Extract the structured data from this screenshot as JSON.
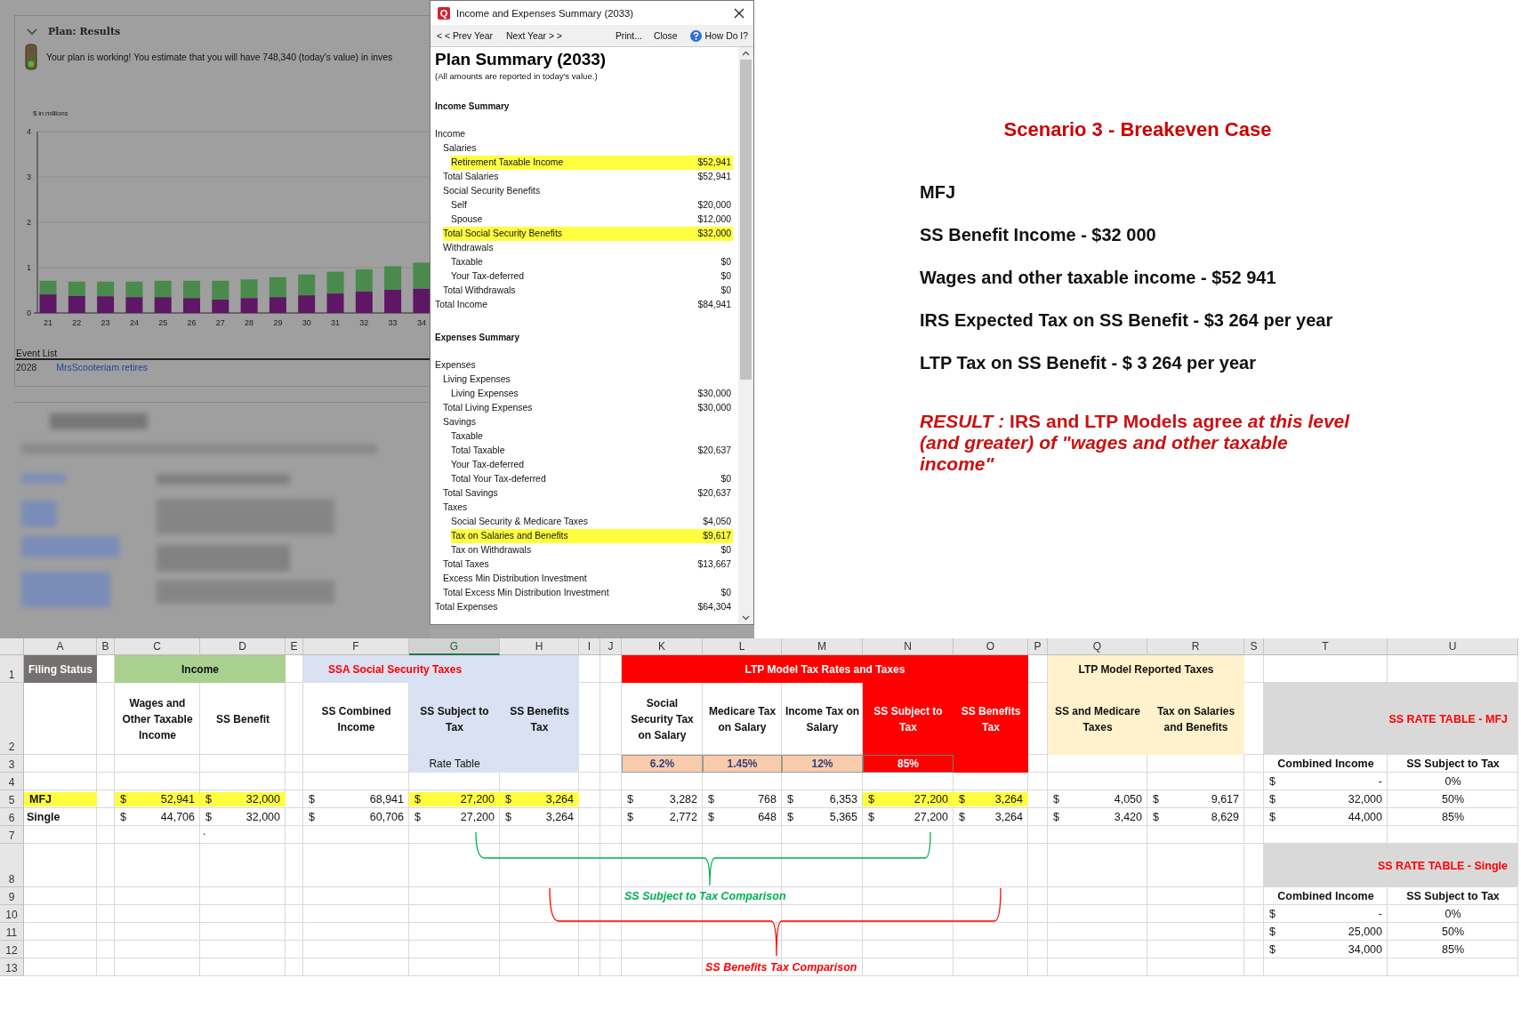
{
  "background_app": {
    "panel_title": "Plan: Results",
    "message": "Your plan is working! You estimate that you will have 748,340 (today's value) in inves",
    "chart_data": {
      "type": "bar",
      "stacked": true,
      "grid": true,
      "ylabel": "$ in millions",
      "categories": [
        "21",
        "22",
        "23",
        "24",
        "25",
        "26",
        "27",
        "28",
        "29",
        "30",
        "31",
        "32",
        "33",
        "34"
      ],
      "yticks": [
        0,
        1,
        2,
        3,
        4
      ],
      "ylim": [
        0,
        4
      ],
      "series": [
        {
          "color": "#5e1764",
          "values": [
            0.41,
            0.38,
            0.37,
            0.35,
            0.35,
            0.33,
            0.3,
            0.33,
            0.35,
            0.39,
            0.43,
            0.47,
            0.51,
            0.54
          ]
        },
        {
          "color": "#4a8a4c",
          "values": [
            0.3,
            0.31,
            0.32,
            0.34,
            0.36,
            0.38,
            0.41,
            0.41,
            0.44,
            0.46,
            0.48,
            0.49,
            0.52,
            0.57
          ]
        }
      ]
    },
    "event_list": {
      "title": "Event List",
      "events": [
        {
          "year": "2028",
          "description": "MrsScooteriam retires"
        }
      ]
    }
  },
  "dialog": {
    "app_icon_letter": "Q",
    "title": "Income and Expenses Summary (2033)",
    "toolbar": [
      {
        "label": "< < Prev Year",
        "kind": "nav"
      },
      {
        "label": "Next Year > >",
        "kind": "nav"
      },
      {
        "label": "Print...",
        "kind": "action"
      },
      {
        "label": "Close",
        "kind": "action"
      },
      {
        "label": "How Do I?",
        "kind": "help"
      }
    ],
    "heading": "Plan Summary (2033)",
    "note": "(All amounts are reported in today's value.)",
    "sections": [
      {
        "heading": "Income Summary",
        "items": [
          {
            "label": "Income",
            "children": [
              {
                "label": "Salaries",
                "children": [
                  {
                    "label": "Retirement Taxable Income",
                    "amount": "$52,941",
                    "highlighted": true
                  }
                ]
              },
              {
                "label": "Total Salaries",
                "amount": "$52,941",
                "highlighted": false
              },
              {
                "label": "Social Security Benefits",
                "children": [
                  {
                    "label": "Self",
                    "amount": "$20,000",
                    "highlighted": false
                  },
                  {
                    "label": "Spouse",
                    "amount": "$12,000",
                    "highlighted": false
                  }
                ]
              },
              {
                "label": "Total Social Security Benefits",
                "amount": "$32,000",
                "highlighted": true
              },
              {
                "label": "Withdrawals",
                "children": [
                  {
                    "label": "Taxable",
                    "amount": "$0",
                    "highlighted": false
                  },
                  {
                    "label": "Your Tax-deferred",
                    "amount": "$0",
                    "highlighted": false
                  }
                ]
              },
              {
                "label": "Total Withdrawals",
                "amount": "$0",
                "highlighted": false
              }
            ]
          },
          {
            "label": "Total Income",
            "amount": "$84,941",
            "highlighted": false
          }
        ]
      },
      {
        "heading": "Expenses Summary",
        "items": [
          {
            "label": "Expenses",
            "children": [
              {
                "label": "Living Expenses",
                "children": [
                  {
                    "label": "Living Expenses",
                    "amount": "$30,000",
                    "highlighted": false
                  }
                ]
              },
              {
                "label": "Total Living Expenses",
                "amount": "$30,000",
                "highlighted": false
              },
              {
                "label": "Savings",
                "children": [
                  {
                    "label": "Taxable"
                  },
                  {
                    "label": "Total Taxable",
                    "amount": "$20,637",
                    "highlighted": false
                  },
                  {
                    "label": "Your Tax-deferred"
                  },
                  {
                    "label": "Total Your Tax-deferred",
                    "amount": "$0",
                    "highlighted": false
                  }
                ]
              },
              {
                "label": "Total Savings",
                "amount": "$20,637",
                "highlighted": false
              },
              {
                "label": "Taxes",
                "children": [
                  {
                    "label": "Social Security & Medicare Taxes",
                    "amount": "$4,050",
                    "highlighted": false
                  },
                  {
                    "label": "Tax on Salaries and Benefits",
                    "amount": "$9,617",
                    "highlighted": true
                  },
                  {
                    "label": "Tax on Withdrawals",
                    "amount": "$0",
                    "highlighted": false
                  }
                ]
              },
              {
                "label": "Total Taxes",
                "amount": "$13,667",
                "highlighted": false
              },
              {
                "label": "Excess Min Distribution Investment"
              },
              {
                "label": "Total Excess Min Distribution Investment",
                "amount": "$0",
                "highlighted": false
              }
            ]
          },
          {
            "label": "Total Expenses",
            "amount": "$64,304",
            "highlighted": false
          }
        ]
      }
    ]
  },
  "scenario": {
    "title": "Scenario 3 - Breakeven Case",
    "lines": [
      "MFJ",
      "SS Benefit Income - $32 000",
      "Wages and other taxable income - $52 941",
      "IRS Expected Tax on SS Benefit -  $3 264 per year",
      "LTP Tax on SS Benefit - $ 3 264 per year"
    ],
    "result": "*RESULT :* IRS and LTP Models agree *at this level (and greater) of \"wages and other taxable income\"*"
  },
  "spreadsheet": {
    "column_letters": [
      {
        "label": "A",
        "selected": false
      },
      {
        "label": "B",
        "selected": false
      },
      {
        "label": "C",
        "selected": false
      },
      {
        "label": "D",
        "selected": false
      },
      {
        "label": "E",
        "selected": false
      },
      {
        "label": "F",
        "selected": false
      },
      {
        "label": "G",
        "selected": true
      },
      {
        "label": "H",
        "selected": false
      },
      {
        "label": "I",
        "selected": false
      },
      {
        "label": "J",
        "selected": false
      },
      {
        "label": "K",
        "selected": false
      },
      {
        "label": "L",
        "selected": false
      },
      {
        "label": "M",
        "selected": false
      },
      {
        "label": "N",
        "selected": false
      },
      {
        "label": "O",
        "selected": false
      },
      {
        "label": "P",
        "selected": false
      },
      {
        "label": "Q",
        "selected": false
      },
      {
        "label": "R",
        "selected": false
      },
      {
        "label": "S",
        "selected": false
      },
      {
        "label": "T",
        "selected": false
      },
      {
        "label": "U",
        "selected": false
      }
    ],
    "row_numbers": [
      "1",
      "2",
      "3",
      "4",
      "5",
      "6",
      "7",
      "8",
      "9",
      "10",
      "11",
      "12",
      "13"
    ],
    "groups": [
      "Filing Status",
      "Income",
      "SSA Social Security Taxes",
      "LTP Model Tax Rates and Taxes",
      "LTP Model Reported Taxes"
    ],
    "headers": [
      "Wages and Other Taxable Income",
      "SS Benefit",
      "SS Combined Income",
      "SS Subject to Tax",
      "SS Benefits Tax",
      "Social Security Tax on Salary",
      "Medicare Tax on Salary",
      "Income Tax on Salary",
      "SS Subject to Tax",
      "SS Benefits Tax",
      "SS and Medicare Taxes",
      "Tax on Salaries and Benefits"
    ],
    "rate_table_label": "Rate Table",
    "rates": [
      "6.2%",
      "1.45%",
      "12%",
      "85%"
    ],
    "rows": [
      {
        "status": "MFJ",
        "status_highlighted": true,
        "cells": [
          {
            "currency": "$",
            "amount": "52,941",
            "highlighted": true
          },
          {
            "currency": "$",
            "amount": "32,000",
            "highlighted": true
          },
          {
            "currency": "$",
            "amount": "68,941",
            "highlighted": false
          },
          {
            "currency": "$",
            "amount": "27,200",
            "highlighted": true
          },
          {
            "currency": "$",
            "amount": "3,264",
            "highlighted": true
          },
          {
            "currency": "$",
            "amount": "3,282",
            "highlighted": false
          },
          {
            "currency": "$",
            "amount": "768",
            "highlighted": false
          },
          {
            "currency": "$",
            "amount": "6,353",
            "highlighted": false
          },
          {
            "currency": "$",
            "amount": "27,200",
            "highlighted": true
          },
          {
            "currency": "$",
            "amount": "3,264",
            "highlighted": true
          },
          {
            "currency": "$",
            "amount": "4,050",
            "highlighted": false
          },
          {
            "currency": "$",
            "amount": "9,617",
            "highlighted": false
          }
        ]
      },
      {
        "status": "Single",
        "status_highlighted": false,
        "cells": [
          {
            "currency": "$",
            "amount": "44,706",
            "highlighted": false
          },
          {
            "currency": "$",
            "amount": "32,000",
            "highlighted": false
          },
          {
            "currency": "$",
            "amount": "60,706",
            "highlighted": false
          },
          {
            "currency": "$",
            "amount": "27,200",
            "highlighted": false
          },
          {
            "currency": "$",
            "amount": "3,264",
            "highlighted": false
          },
          {
            "currency": "$",
            "amount": "2,772",
            "highlighted": false
          },
          {
            "currency": "$",
            "amount": "648",
            "highlighted": false
          },
          {
            "currency": "$",
            "amount": "5,365",
            "highlighted": false
          },
          {
            "currency": "$",
            "amount": "27,200",
            "highlighted": false
          },
          {
            "currency": "$",
            "amount": "3,264",
            "highlighted": false
          },
          {
            "currency": "$",
            "amount": "3,420",
            "highlighted": false
          },
          {
            "currency": "$",
            "amount": "8,629",
            "highlighted": false
          }
        ]
      }
    ],
    "stray_mark": ".",
    "rate_tables": [
      {
        "title": "SS RATE TABLE - MFJ",
        "columns": [
          "Combined Income",
          "SS Subject to Tax"
        ],
        "rows": [
          {
            "currency": "$",
            "income": "-",
            "share": "0%"
          },
          {
            "currency": "$",
            "income": "32,000",
            "share": "50%"
          },
          {
            "currency": "$",
            "income": "44,000",
            "share": "85%"
          }
        ]
      },
      {
        "title": "SS RATE TABLE - Single",
        "columns": [
          "Combined Income",
          "SS Subject to Tax"
        ],
        "rows": [
          {
            "currency": "$",
            "income": "-",
            "share": "0%"
          },
          {
            "currency": "$",
            "income": "25,000",
            "share": "50%"
          },
          {
            "currency": "$",
            "income": "34,000",
            "share": "85%"
          }
        ]
      }
    ],
    "annotations": [
      {
        "text": "SS Subject to Tax Comparison",
        "color": "#00b050"
      },
      {
        "text": "SS Benefits Tax Comparison",
        "color": "#ff0000"
      }
    ]
  }
}
